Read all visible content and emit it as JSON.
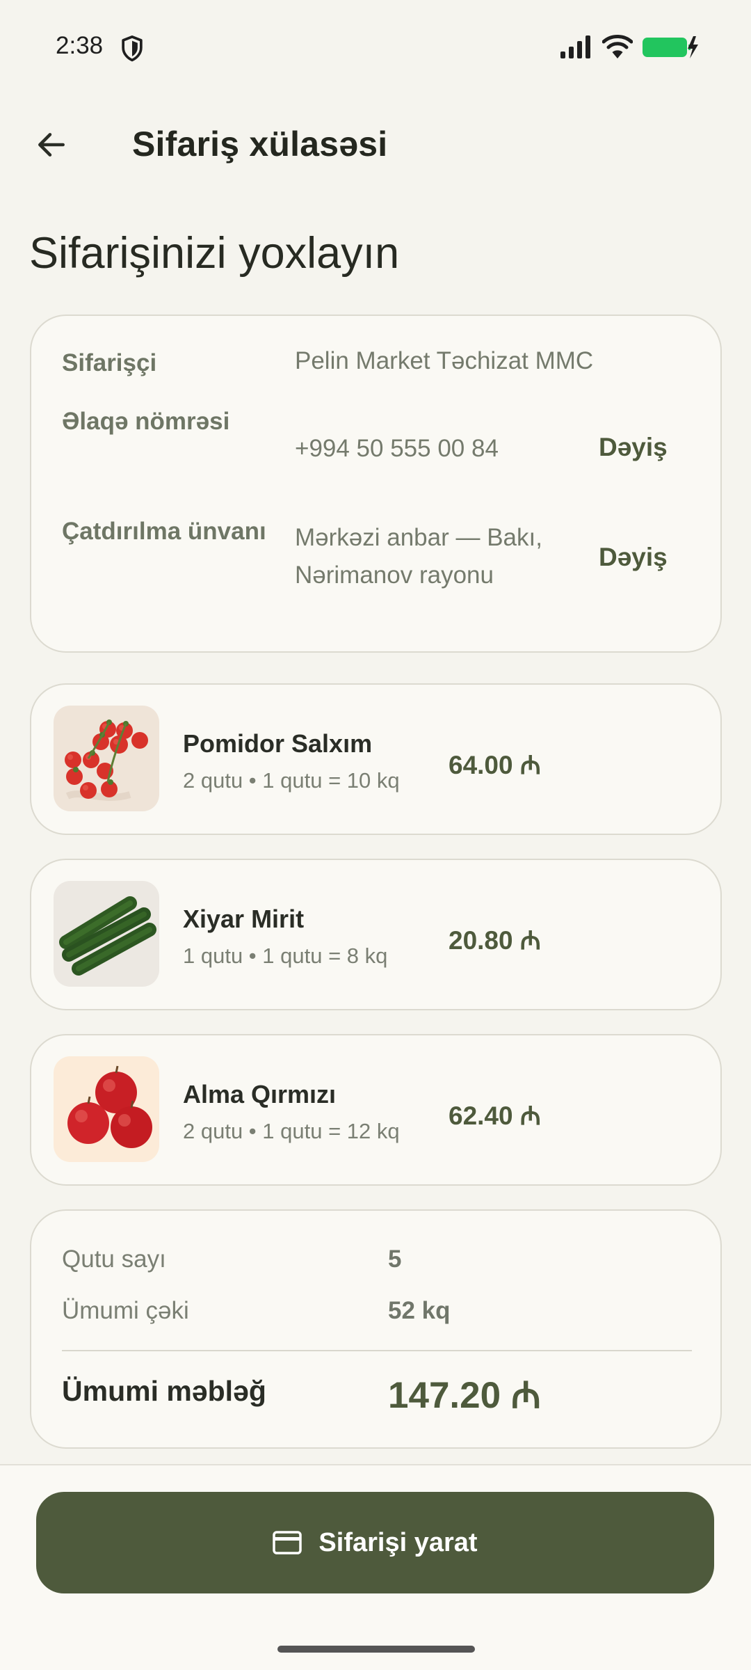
{
  "status_bar": {
    "time": "2:38"
  },
  "app_bar": {
    "title": "Sifariş xülasəsi"
  },
  "page": {
    "heading": "Sifarişinizi yoxlayın"
  },
  "info": {
    "customer_label": "Sifarişçi",
    "customer_value": "Pelin Market Təchizat MMC",
    "phone_label": "Əlaqə nömrəsi",
    "phone_value": "+994 50 555 00 84",
    "address_label": "Çatdırılma ünvanı",
    "address_line1": "Mərkəzi anbar — Bakı,",
    "address_line2": "Nərimanov rayonu",
    "change_label": "Dəyiş"
  },
  "items": [
    {
      "name": "Pomidor Salxım",
      "meta": "2 qutu • 1 qutu = 10 kq",
      "price": "64.00 ₼"
    },
    {
      "name": "Xiyar Mirit",
      "meta": "1 qutu • 1 qutu = 8 kq",
      "price": "20.80 ₼"
    },
    {
      "name": "Alma Qırmızı",
      "meta": "2 qutu • 1 qutu = 12 kq",
      "price": "62.40 ₼"
    }
  ],
  "summary": {
    "box_count_label": "Qutu sayı",
    "box_count_value": "5",
    "weight_label": "Ümumi çəki",
    "weight_value": "52 kq",
    "total_label": "Ümumi məbləğ",
    "total_value": "147.20 ₼"
  },
  "action": {
    "create_label": "Sifarişi yarat"
  },
  "colors": {
    "primary": "#4E5A3C",
    "background": "#F5F4EE",
    "card": "#FAF9F4",
    "battery": "#22C55E"
  },
  "icons": {
    "back": "arrow-left-icon",
    "create": "credit-card-icon",
    "status": [
      "shield-icon",
      "signal-icon",
      "wifi-icon",
      "battery-charging-icon"
    ]
  }
}
